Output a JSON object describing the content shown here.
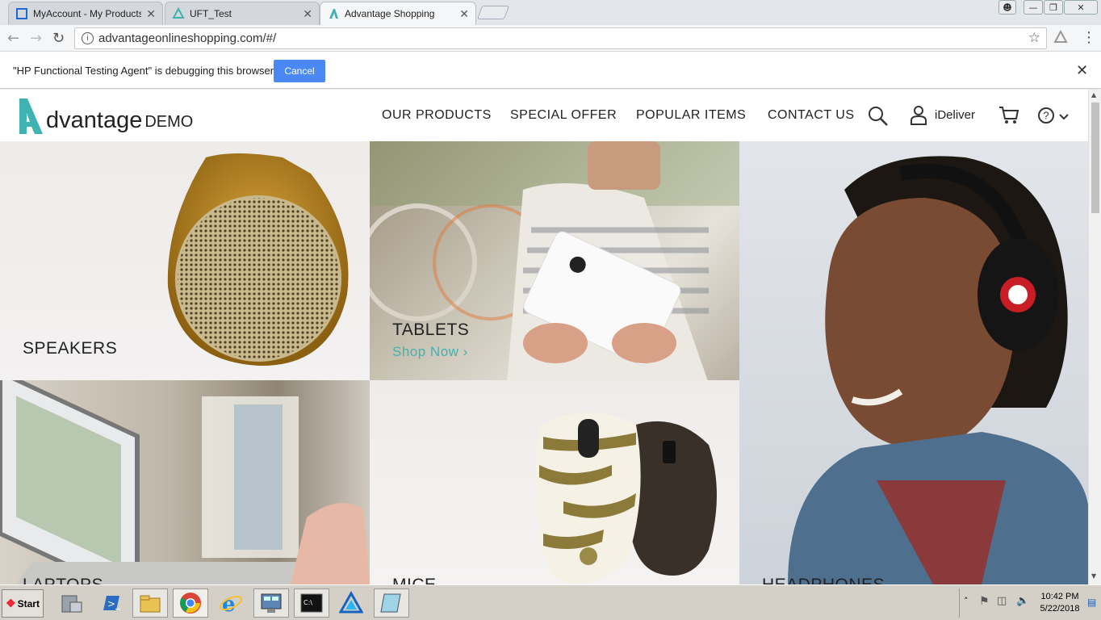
{
  "browser": {
    "tabs": [
      {
        "label": "MyAccount - My Products",
        "icon": "page-icon"
      },
      {
        "label": "UFT_Test",
        "icon": "triangle-icon"
      },
      {
        "label": "Advantage Shopping",
        "icon": "advantage-icon"
      }
    ],
    "url": "advantageonlineshopping.com/#/",
    "infobar": {
      "message": "\"HP Functional Testing Agent\" is debugging this browser",
      "cancel_label": "Cancel"
    }
  },
  "site": {
    "logo": {
      "word": "dvantage",
      "demo": "DEMO"
    },
    "nav": [
      "OUR PRODUCTS",
      "SPECIAL OFFER",
      "POPULAR ITEMS",
      "CONTACT US"
    ],
    "user_name": "iDeliver",
    "accent_color": "#3eb3b1",
    "categories": {
      "speakers": "SPEAKERS",
      "tablets": "TABLETS",
      "shop_now": "Shop Now",
      "laptops": "LAPTOPS",
      "mice": "MICE",
      "headphones": "HEADPHONES"
    }
  },
  "taskbar": {
    "start_label": "Start",
    "time": "10:42 PM",
    "date": "5/22/2018"
  }
}
